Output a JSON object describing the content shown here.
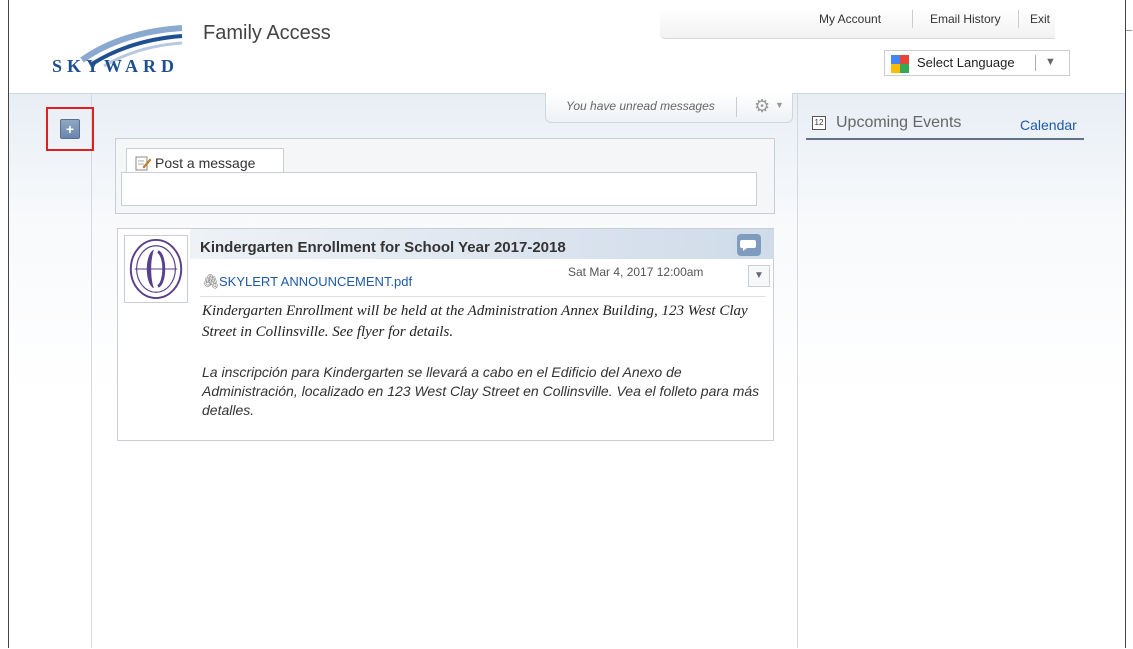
{
  "header": {
    "brand": "SKYWARD",
    "app_title": "Family Access",
    "nav": [
      "My Account",
      "Email History",
      "Exit"
    ],
    "language": "Select Language"
  },
  "toolbar": {
    "add_button": "+",
    "unread": "You have unread messages"
  },
  "post": {
    "tab_label": "Post a message",
    "input_value": ""
  },
  "message": {
    "title": "Kindergarten Enrollment for School Year 2017-2018",
    "attachment": "SKYLERT ANNOUNCEMENT.pdf",
    "date": "Sat Mar 4, 2017 12:00am",
    "body_en": "Kindergarten Enrollment will be held at the Administration Annex Building, 123 West Clay Street in Collinsville.  See flyer for details.",
    "body_es": "La inscripción para Kindergarten se llevará a cabo en el Edificio del Anexo de Administración, localizado en 123 West Clay Street en Collinsville.  Vea el folleto para más detalles."
  },
  "sidebar": {
    "events_title": "Upcoming Events",
    "calendar_link": "Calendar",
    "events_icon_text": "12"
  },
  "colors": {
    "accent": "#1d5aa8",
    "highlight": "#e02020",
    "brand": "#1d4f91"
  }
}
